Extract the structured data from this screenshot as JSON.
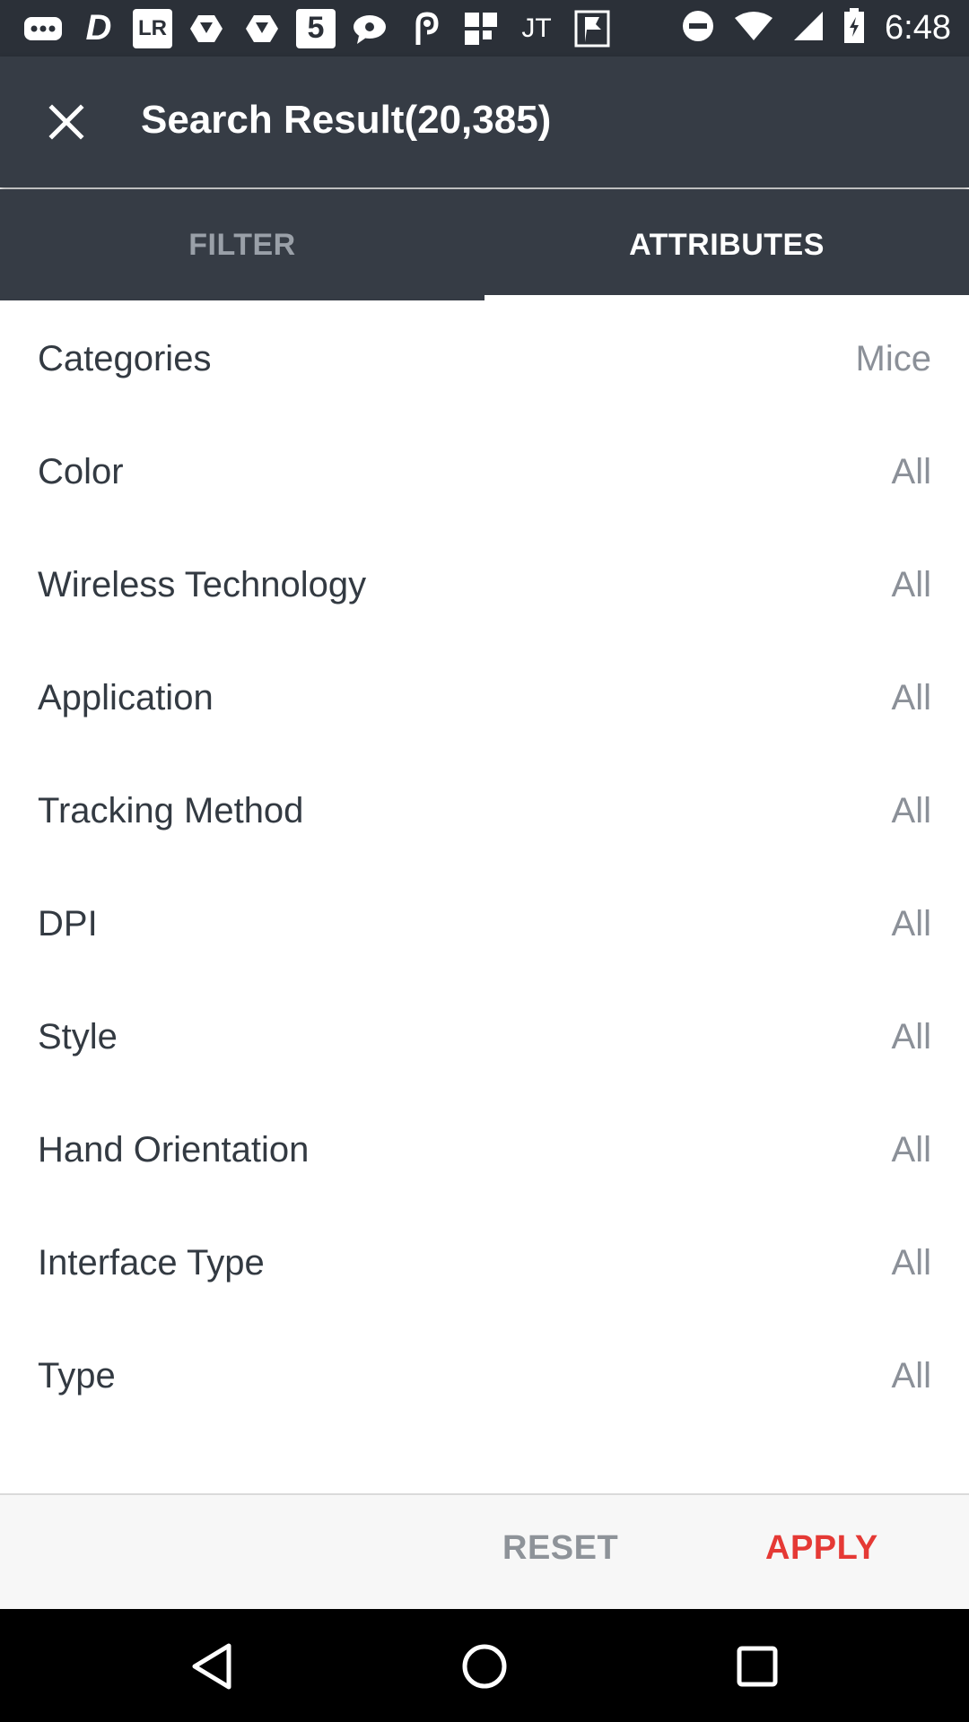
{
  "status_bar": {
    "time": "6:48",
    "left_icons": [
      "more-icon",
      "d-icon",
      "lr-icon",
      "hexagon-icon",
      "hexagon-icon",
      "5-icon",
      "chat-icon",
      "link-icon",
      "grid-icon",
      "jt-icon",
      "flag-icon"
    ],
    "lr_text": "LR",
    "five_text": "5",
    "jt_text": "JT"
  },
  "app_bar": {
    "title": "Search Result(20,385)"
  },
  "tabs": [
    {
      "label": "FILTER",
      "active": false
    },
    {
      "label": "ATTRIBUTES",
      "active": true
    }
  ],
  "attributes": [
    {
      "label": "Categories",
      "value": "Mice"
    },
    {
      "label": "Color",
      "value": "All"
    },
    {
      "label": "Wireless Technology",
      "value": "All"
    },
    {
      "label": "Application",
      "value": "All"
    },
    {
      "label": "Tracking Method",
      "value": "All"
    },
    {
      "label": "DPI",
      "value": "All"
    },
    {
      "label": "Style",
      "value": "All"
    },
    {
      "label": "Hand Orientation",
      "value": "All"
    },
    {
      "label": "Interface Type",
      "value": "All"
    },
    {
      "label": "Type",
      "value": "All"
    }
  ],
  "actions": {
    "reset_label": "RESET",
    "apply_label": "APPLY",
    "apply_color": "#e53935"
  },
  "colors": {
    "app_bar": "#363c45",
    "status_bar": "#2b3038"
  }
}
